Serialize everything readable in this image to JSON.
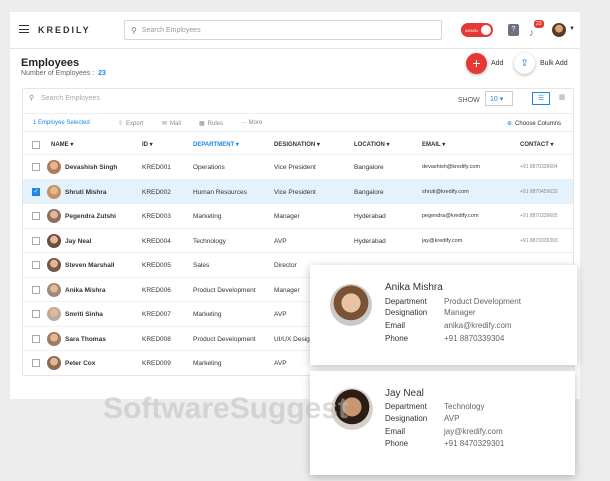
{
  "topbar": {
    "logo": "KREDILY",
    "search_placeholder": "Search Employees",
    "toggle_label": "ADMIN",
    "help": "?",
    "notification_count": "23",
    "icons": {
      "menu": "hamburger-icon",
      "search": "search-icon",
      "bell": "bell-icon",
      "caret": "chevron-down-icon"
    }
  },
  "header": {
    "title": "Employees",
    "subtitle": "Number of Employees :",
    "count": "23",
    "add_label": "Add",
    "bulk_add_label": "Bulk Add"
  },
  "table_controls": {
    "search_placeholder": "Search Employees",
    "show_label": "SHOW",
    "show_value": "10 ▾",
    "selected_label": "1  Employee Selected",
    "export_label": "Export",
    "mail_label": "Mail",
    "rules_label": "Rules",
    "more_label": "···  More",
    "choose_columns_label": "Choose Columns"
  },
  "columns": [
    "NAME ▾",
    "ID ▾",
    "DEPARTMENT ▾",
    "DESIGNATION ▾",
    "LOCATION ▾",
    "EMAIL ▾",
    "CONTACT ▾"
  ],
  "rows": [
    {
      "name": "Devashish Singh",
      "id": "KRED001",
      "dept": "Operations",
      "desig": "Vice President",
      "loc": "Bangalore",
      "email": "devashish@kredify.com",
      "phone": "+91 8870339604",
      "checked": false
    },
    {
      "name": "Shruti Mishra",
      "id": "KRED002",
      "dept": "Human Resources",
      "desig": "Vice President",
      "loc": "Bangalore",
      "email": "shruti@kredify.com",
      "phone": "+91 8870459632",
      "checked": true
    },
    {
      "name": "Pegendra Zutshi",
      "id": "KRED003",
      "dept": "Marketing",
      "desig": "Manager",
      "loc": "Hyderabad",
      "email": "pegendra@kredify.com",
      "phone": "+91 8870339605",
      "checked": false
    },
    {
      "name": "Jay Neal",
      "id": "KRED004",
      "dept": "Technology",
      "desig": "AVP",
      "loc": "Hyderabad",
      "email": "jay@kredify.com",
      "phone": "+91 8870339303",
      "checked": false
    },
    {
      "name": "Steven Marshall",
      "id": "KRED005",
      "dept": "Sales",
      "desig": "Director",
      "loc": "",
      "email": "",
      "phone": "",
      "checked": false
    },
    {
      "name": "Anika Mishra",
      "id": "KRED006",
      "dept": "Product Development",
      "desig": "Manager",
      "loc": "",
      "email": "",
      "phone": "",
      "checked": false
    },
    {
      "name": "Smriti Sinha",
      "id": "KRED007",
      "dept": "Marketing",
      "desig": "AVP",
      "loc": "",
      "email": "",
      "phone": "",
      "checked": false
    },
    {
      "name": "Sara Thomas",
      "id": "KRED008",
      "dept": "Product Development",
      "desig": "UI/UX Design",
      "loc": "",
      "email": "",
      "phone": "",
      "checked": false
    },
    {
      "name": "Peter Cox",
      "id": "KRED009",
      "dept": "Marketing",
      "desig": "AVP",
      "loc": "",
      "email": "",
      "phone": "",
      "checked": false
    }
  ],
  "popup_anika": {
    "name": "Anika Mishra",
    "department_label": "Department",
    "department": "Product Development",
    "designation_label": "Designation",
    "designation": "Manager",
    "email_label": "Email",
    "email": "anika@kredify.com",
    "phone_label": "Phone",
    "phone": "+91 8870339304"
  },
  "popup_jay": {
    "name": "Jay Neal",
    "department_label": "Department",
    "department": "Technology",
    "designation_label": "Designation",
    "designation": "AVP",
    "email_label": "Email",
    "email": "jay@kredify.com",
    "phone_label": "Phone",
    "phone": "+91 8470329301"
  },
  "watermark": "SoftwareSuggest",
  "colors": {
    "accent": "#1e88e5",
    "brand": "#e53935",
    "selected_row": "#e3f2fd"
  }
}
